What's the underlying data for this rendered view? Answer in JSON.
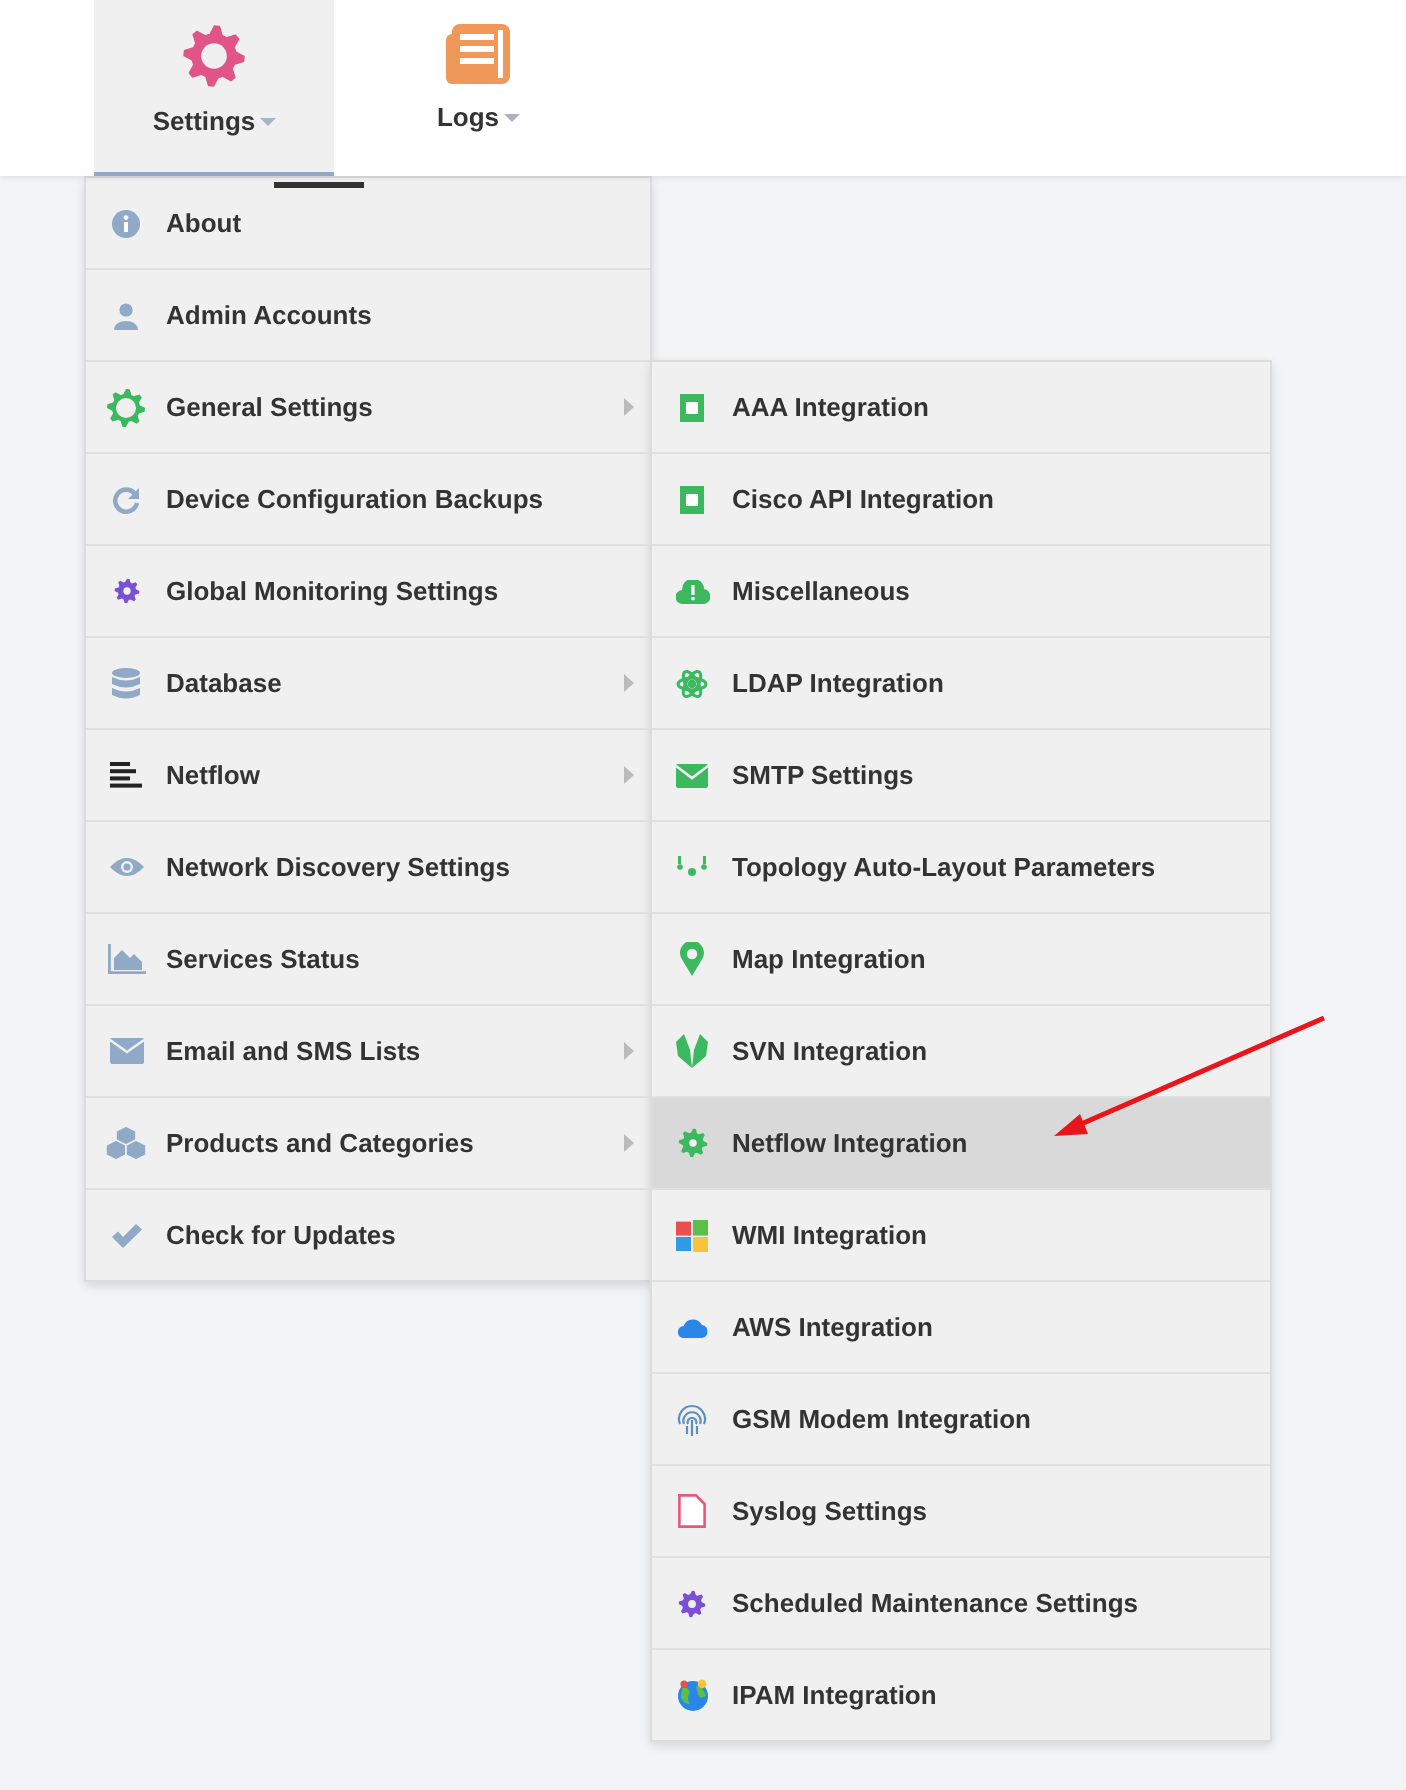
{
  "nav_tabs": [
    {
      "label": "Settings",
      "selected": true,
      "has_dropdown": true
    },
    {
      "label": "Logs",
      "selected": false,
      "has_dropdown": true
    }
  ],
  "settings_menu": [
    {
      "label": "About",
      "has_submenu": false
    },
    {
      "label": "Admin Accounts",
      "has_submenu": false
    },
    {
      "label": "General Settings",
      "has_submenu": true
    },
    {
      "label": "Device Configuration Backups",
      "has_submenu": false
    },
    {
      "label": "Global Monitoring Settings",
      "has_submenu": false
    },
    {
      "label": "Database",
      "has_submenu": true
    },
    {
      "label": "Netflow",
      "has_submenu": true
    },
    {
      "label": "Network Discovery Settings",
      "has_submenu": false
    },
    {
      "label": "Services Status",
      "has_submenu": false
    },
    {
      "label": "Email and SMS Lists",
      "has_submenu": true
    },
    {
      "label": "Products and Categories",
      "has_submenu": true
    },
    {
      "label": "Check for Updates",
      "has_submenu": false
    }
  ],
  "general_settings_submenu": [
    {
      "label": "AAA Integration",
      "selected": false
    },
    {
      "label": "Cisco API Integration",
      "selected": false
    },
    {
      "label": "Miscellaneous",
      "selected": false
    },
    {
      "label": "LDAP Integration",
      "selected": false
    },
    {
      "label": "SMTP Settings",
      "selected": false
    },
    {
      "label": "Topology Auto-Layout Parameters",
      "selected": false
    },
    {
      "label": "Map Integration",
      "selected": false
    },
    {
      "label": "SVN Integration",
      "selected": false
    },
    {
      "label": "Netflow Integration",
      "selected": true
    },
    {
      "label": "WMI Integration",
      "selected": false
    },
    {
      "label": "AWS Integration",
      "selected": false
    },
    {
      "label": "GSM Modem Integration",
      "selected": false
    },
    {
      "label": "Syslog Settings",
      "selected": false
    },
    {
      "label": "Scheduled Maintenance Settings",
      "selected": false
    },
    {
      "label": "IPAM Integration",
      "selected": false
    }
  ]
}
